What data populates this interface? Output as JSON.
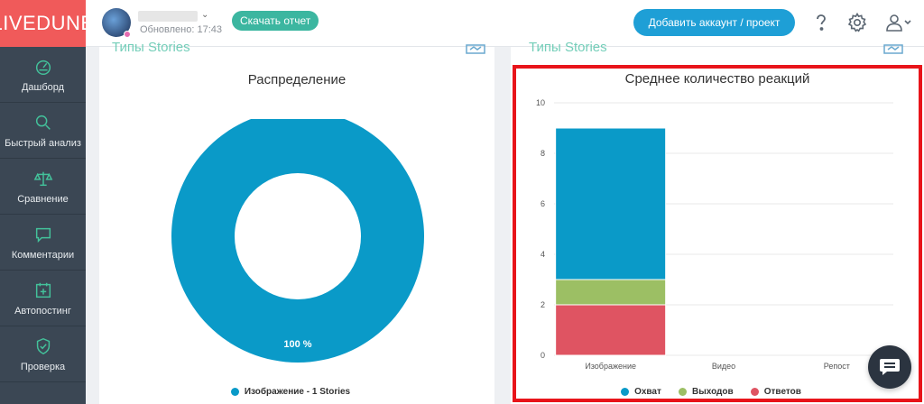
{
  "brand": {
    "logo": "LIVEDUNE",
    "logo_color": "#f05a5a"
  },
  "sidebar": {
    "items": [
      {
        "label": "Дашборд",
        "icon": "dashboard-icon"
      },
      {
        "label": "Быстрый анализ",
        "icon": "search-icon"
      },
      {
        "label": "Сравнение",
        "icon": "scales-icon"
      },
      {
        "label": "Комментарии",
        "icon": "comment-icon"
      },
      {
        "label": "Автопостинг",
        "icon": "calendar-plus-icon"
      },
      {
        "label": "Проверка",
        "icon": "shield-check-icon"
      }
    ]
  },
  "header": {
    "updated": "Обновлено: 17:43",
    "report_button": "Скачать отчет",
    "add_button": "Добавить аккаунт / проект",
    "icons": [
      "help-icon",
      "gear-icon",
      "user-icon"
    ]
  },
  "left_card": {
    "section_tag": "Типы Stories",
    "title": "Распределение",
    "slice_label": "100 %",
    "legend": [
      {
        "label": "Изображение - 1 Stories",
        "color": "#0a9ac8"
      }
    ]
  },
  "right_card": {
    "section_tag": "Типы Stories",
    "title": "Среднее количество реакций",
    "legend": [
      {
        "label": "Охват",
        "color": "#0a9ac8"
      },
      {
        "label": "Выходов",
        "color": "#9cbf64"
      },
      {
        "label": "Ответов",
        "color": "#df5462"
      }
    ]
  },
  "chart_data": [
    {
      "type": "pie",
      "title": "Распределение",
      "categories": [
        "Изображение - 1 Stories"
      ],
      "values": [
        100
      ],
      "colors": [
        "#0a9ac8"
      ],
      "legend": "bottom"
    },
    {
      "type": "bar",
      "stacked": true,
      "title": "Среднее количество реакций",
      "categories": [
        "Изображение",
        "Видео",
        "Репост"
      ],
      "series": [
        {
          "name": "Ответов",
          "values": [
            2,
            0,
            0
          ],
          "color": "#df5462"
        },
        {
          "name": "Выходов",
          "values": [
            1,
            0,
            0
          ],
          "color": "#9cbf64"
        },
        {
          "name": "Охват",
          "values": [
            6,
            0,
            0
          ],
          "color": "#0a9ac8"
        }
      ],
      "yticks": [
        0,
        2,
        4,
        6,
        8,
        10
      ],
      "ylim": [
        0,
        10
      ],
      "grid": true,
      "legend": "bottom"
    }
  ],
  "chat": {
    "icon": "chat-icon"
  }
}
